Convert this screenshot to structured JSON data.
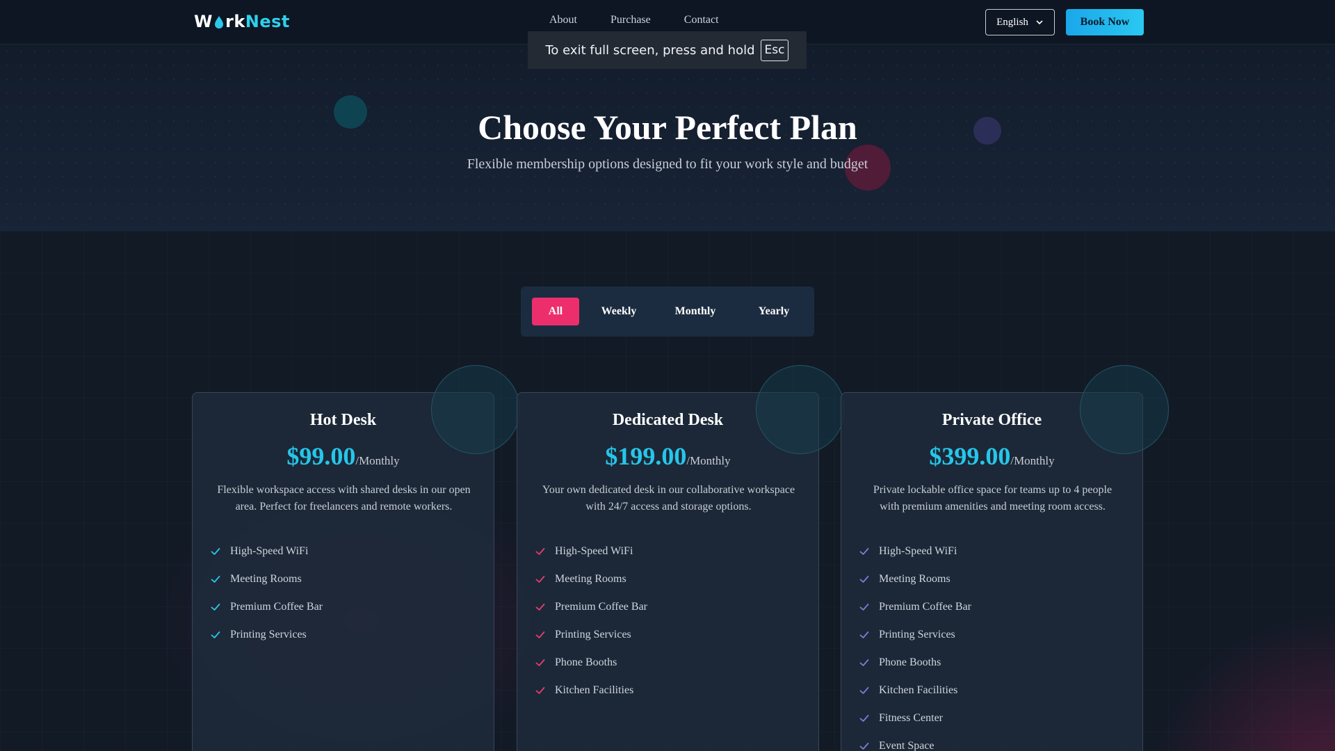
{
  "header": {
    "logo": {
      "prefix": "W",
      "middle": "rk",
      "suffix": "Nest"
    },
    "nav": [
      "About",
      "Purchase",
      "Contact"
    ],
    "language": "English",
    "book_button": "Book Now"
  },
  "toast": {
    "text": "To exit full screen, press and hold",
    "key": "Esc"
  },
  "hero": {
    "title": "Choose Your Perfect Plan",
    "subtitle": "Flexible membership options designed to fit your work style and budget"
  },
  "filters": {
    "options": [
      "All",
      "Weekly",
      "Monthly",
      "Yearly"
    ],
    "selected": "All"
  },
  "plans": [
    {
      "name": "Hot Desk",
      "price": "$99.00",
      "period": "/Monthly",
      "description": "Flexible workspace access with shared desks in our open area. Perfect for freelancers and remote workers.",
      "check_color": "#2bc8e8",
      "features": [
        "High-Speed WiFi",
        "Meeting Rooms",
        "Premium Coffee Bar",
        "Printing Services"
      ]
    },
    {
      "name": "Dedicated Desk",
      "price": "$199.00",
      "period": "/Monthly",
      "description": "Your own dedicated desk in our collaborative workspace with 24/7 access and storage options.",
      "check_color": "#e63d74",
      "features": [
        "High-Speed WiFi",
        "Meeting Rooms",
        "Premium Coffee Bar",
        "Printing Services",
        "Phone Booths",
        "Kitchen Facilities"
      ]
    },
    {
      "name": "Private Office",
      "price": "$399.00",
      "period": "/Monthly",
      "description": "Private lockable office space for teams up to 4 people with premium amenities and meeting room access.",
      "check_color": "#7a7fd6",
      "features": [
        "High-Speed WiFi",
        "Meeting Rooms",
        "Premium Coffee Bar",
        "Printing Services",
        "Phone Booths",
        "Kitchen Facilities",
        "Fitness Center",
        "Event Space"
      ]
    }
  ],
  "colors": {
    "accent": "#26c6ea",
    "active_filter": "#ec2f6c",
    "background": "#111824"
  }
}
